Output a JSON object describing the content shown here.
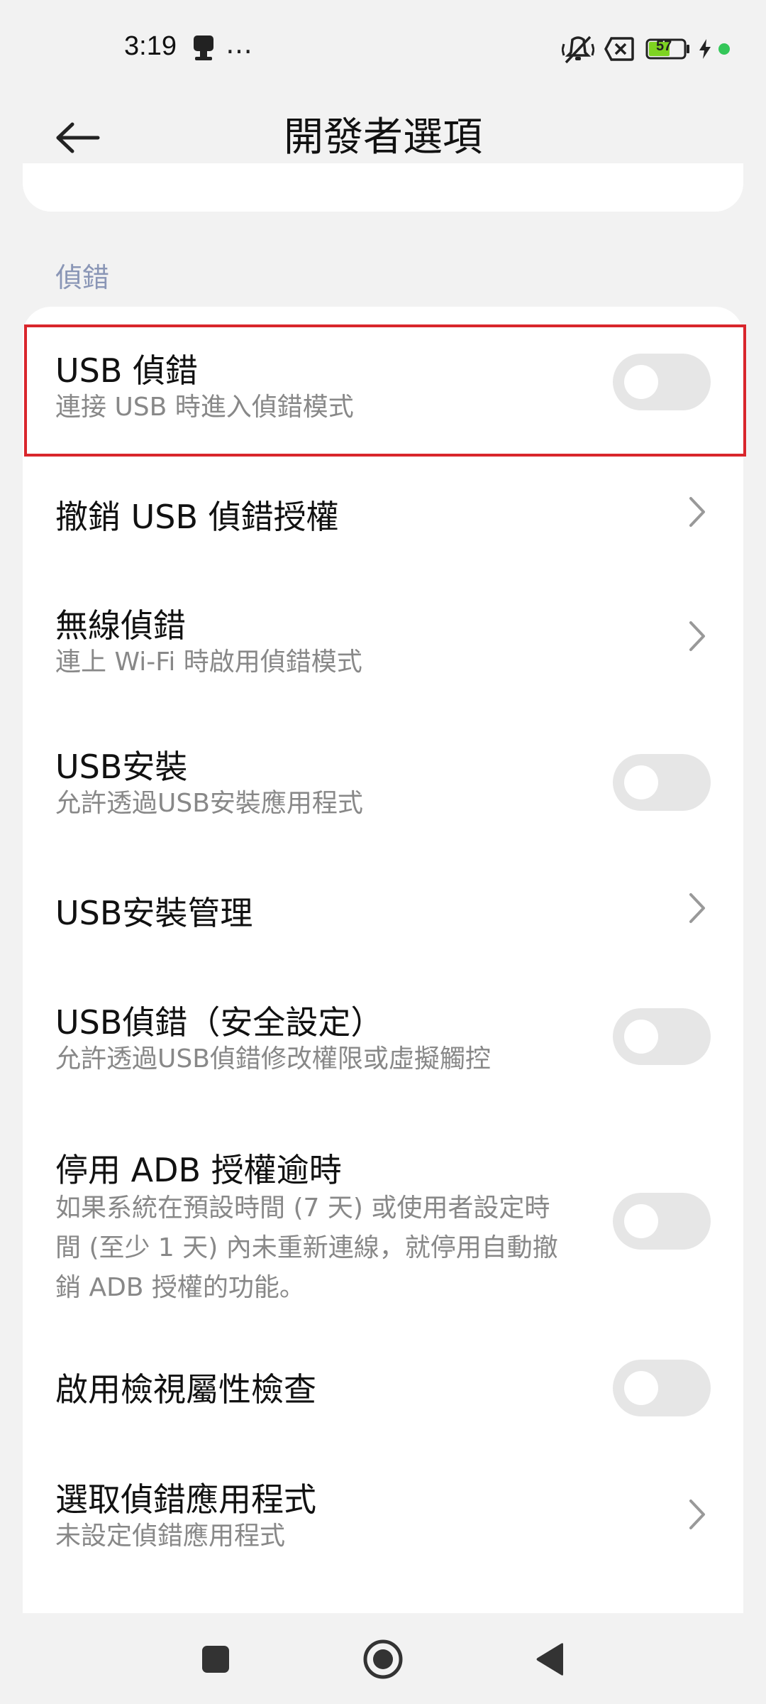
{
  "status_bar": {
    "time": "3:19",
    "more": "…",
    "battery_level": "57"
  },
  "header": {
    "title": "開發者選項"
  },
  "section": {
    "title": "偵錯"
  },
  "items": [
    {
      "title": "USB 偵錯",
      "subtitle": "連接 USB 時進入偵錯模式",
      "control": "toggle",
      "on": false
    },
    {
      "title": "撤銷 USB 偵錯授權",
      "control": "chevron"
    },
    {
      "title": "無線偵錯",
      "subtitle": "連上 Wi-Fi 時啟用偵錯模式",
      "control": "chevron"
    },
    {
      "title": "USB安裝",
      "subtitle": "允許透過USB安裝應用程式",
      "control": "toggle",
      "on": false
    },
    {
      "title": "USB安裝管理",
      "control": "chevron"
    },
    {
      "title": "USB偵錯（安全設定）",
      "subtitle": "允許透過USB偵錯修改權限或虛擬觸控",
      "control": "toggle",
      "on": false
    },
    {
      "title": "停用 ADB 授權逾時",
      "subtitle_lines": [
        "如果系統在預設時間 (7 天) 或使用者設定時",
        "間 (至少 1 天) 內未重新連線，就停用自動撤",
        "銷 ADB 授權的功能。"
      ],
      "control": "toggle",
      "on": false
    },
    {
      "title": "啟用檢視屬性檢查",
      "control": "toggle",
      "on": false
    },
    {
      "title": "選取偵錯應用程式",
      "subtitle": "未設定偵錯應用程式",
      "control": "chevron"
    }
  ],
  "colors": {
    "highlight": "#d9262c",
    "section_header": "#8a96b6",
    "battery_fill": "#7ed321",
    "charging_dot": "#34c759"
  }
}
